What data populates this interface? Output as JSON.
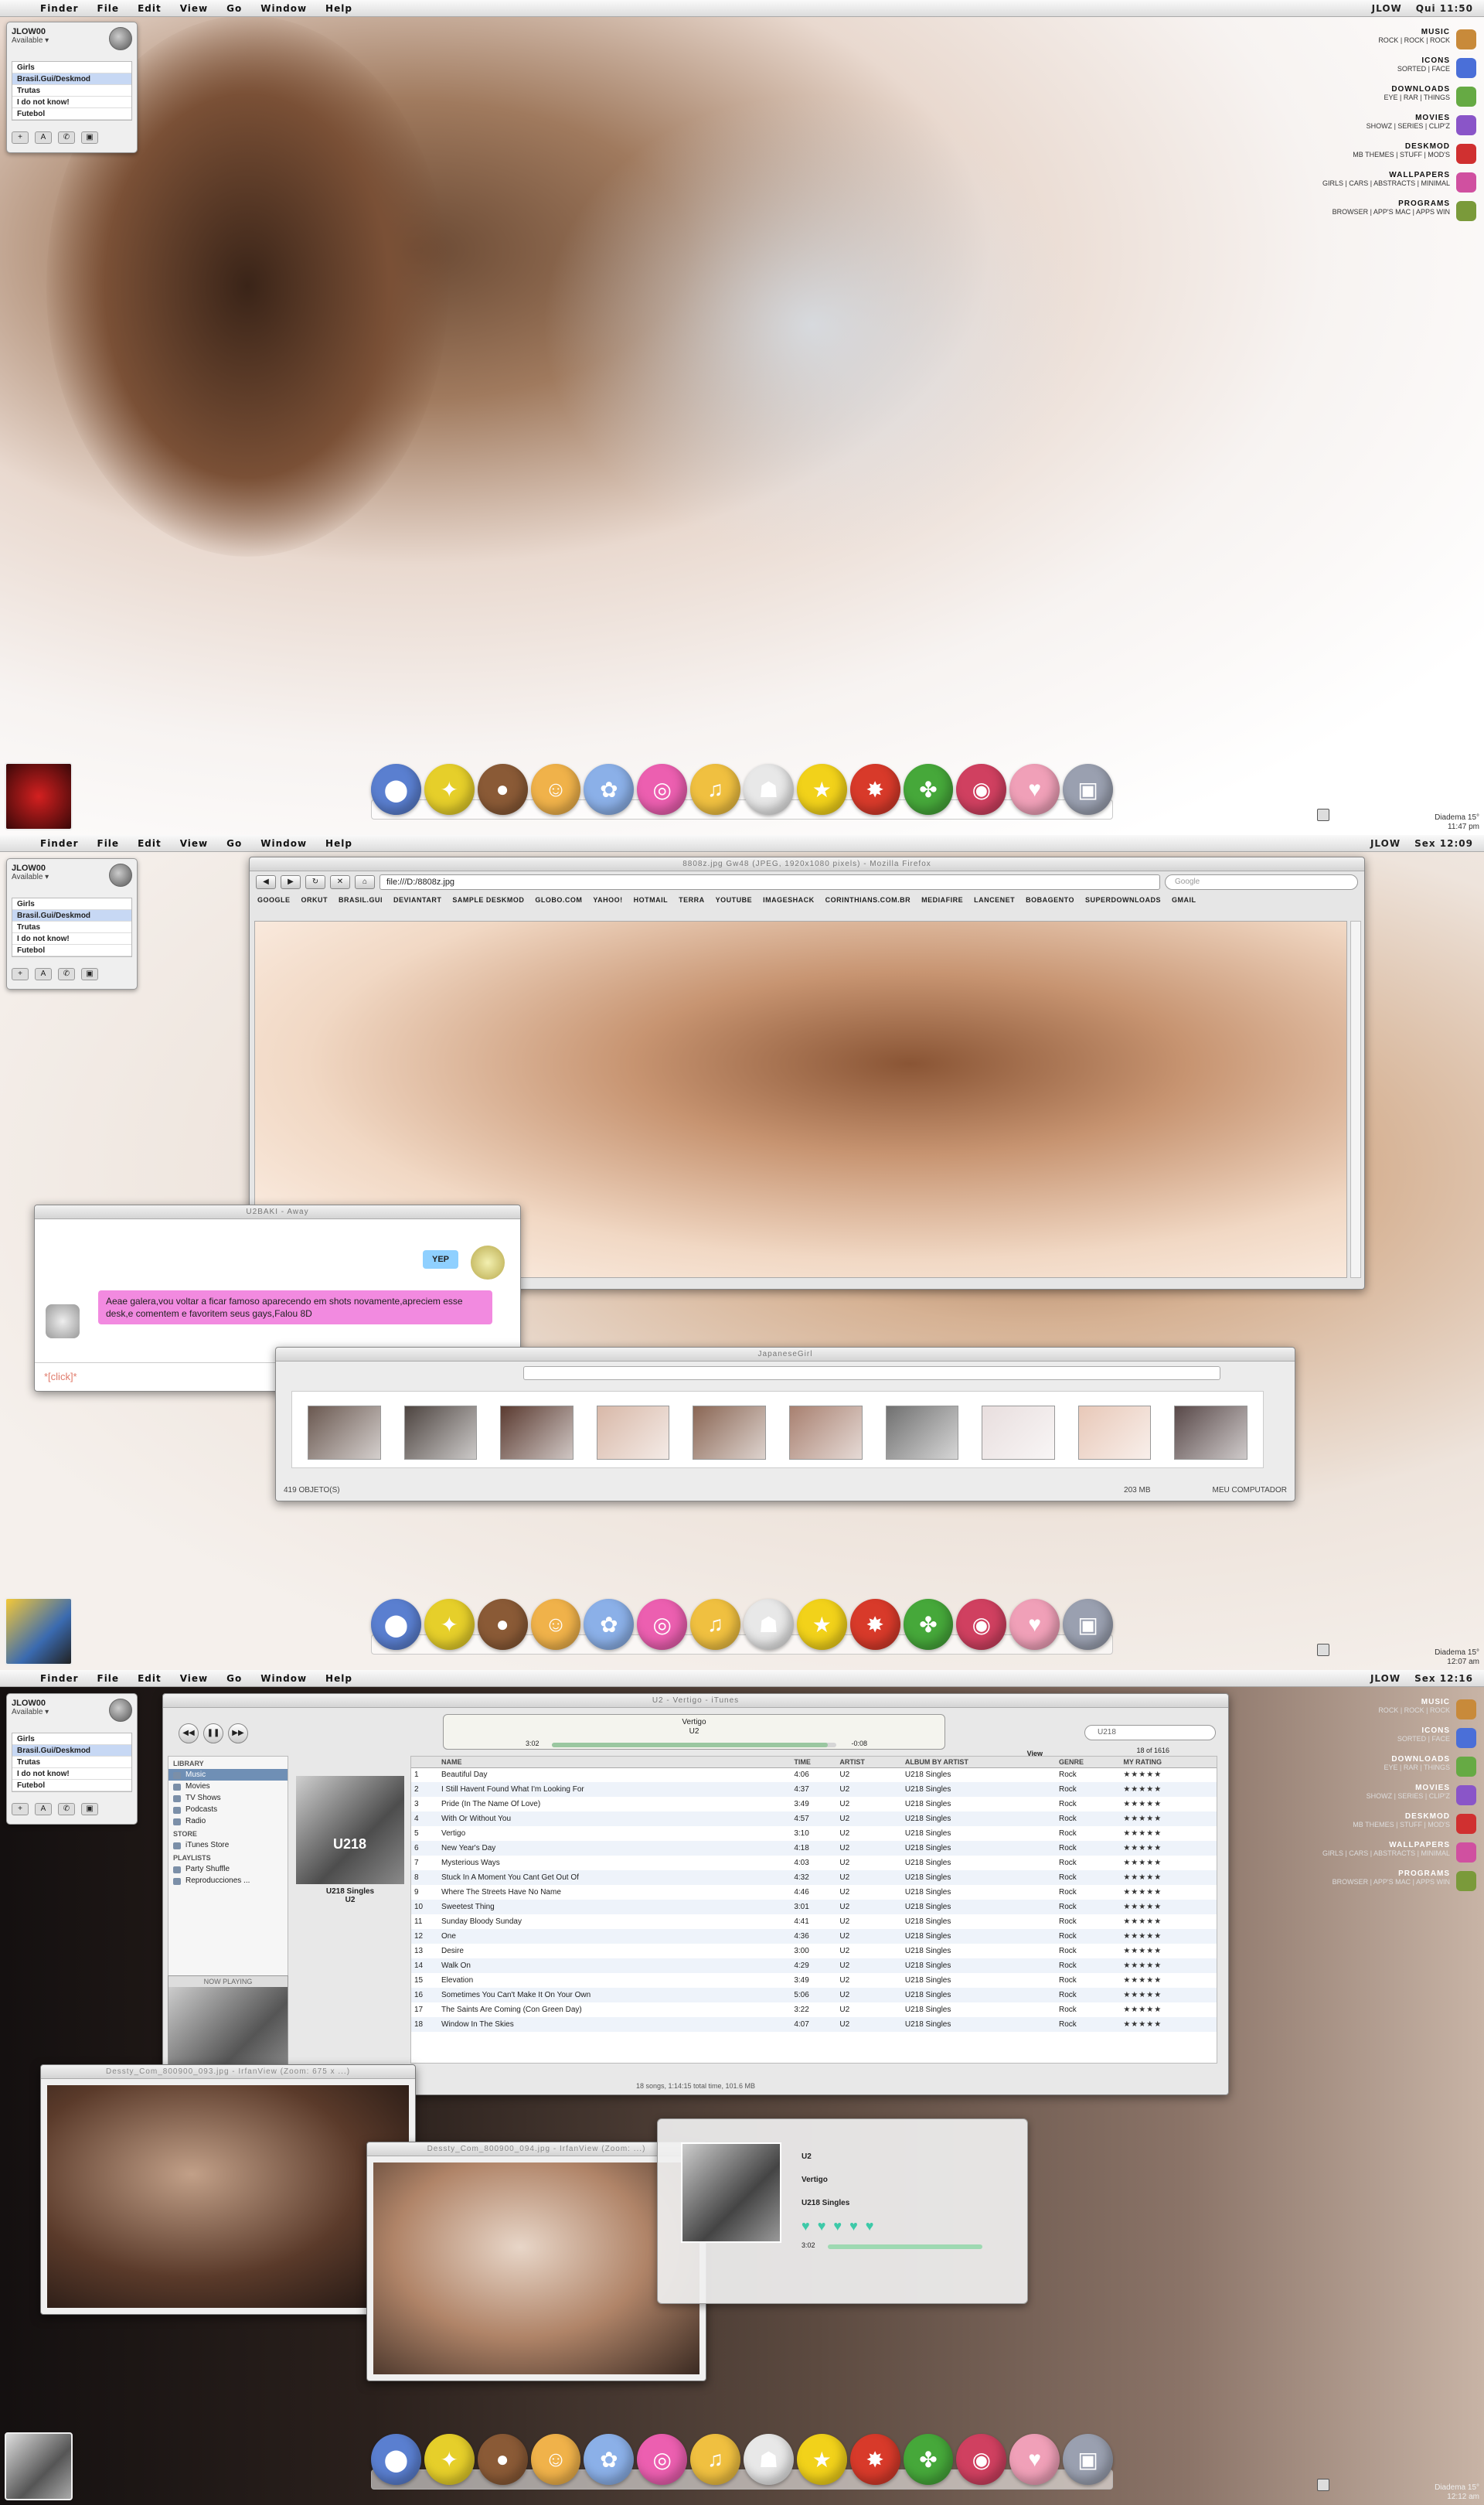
{
  "menu": [
    "Finder",
    "File",
    "Edit",
    "View",
    "Go",
    "Window",
    "Help"
  ],
  "screen1": {
    "user": "JLOW",
    "clock": "Qui 11:50",
    "corner_clock": [
      "Diadema  15°",
      "11:47 pm"
    ]
  },
  "screen2": {
    "user": "JLOW",
    "clock": "Sex 12:09",
    "corner_clock": [
      "Diadema  15°",
      "12:07 am"
    ]
  },
  "screen3": {
    "user": "JLOW",
    "clock": "Sex 12:16",
    "corner_clock": [
      "Diadema  15°",
      "12:12 am"
    ]
  },
  "buddy": {
    "name": "JLOW00",
    "status": "Available ▾",
    "groups": [
      "Girls",
      "Brasil.Gui/Deskmod",
      "Trutas",
      "I do not know!",
      "Futebol"
    ]
  },
  "sidelinks": [
    {
      "title": "Music",
      "sub": "rock | rock | rock",
      "color": "#c88a3a"
    },
    {
      "title": "Icons",
      "sub": "sorted | face",
      "color": "#4a6fd8"
    },
    {
      "title": "Downloads",
      "sub": "eye | rar | things",
      "color": "#66aa44"
    },
    {
      "title": "Movies",
      "sub": "showz | series | clip'z",
      "color": "#8a55c8"
    },
    {
      "title": "Deskmod",
      "sub": "mb themes | stuff | mod's",
      "color": "#d03030"
    },
    {
      "title": "Wallpapers",
      "sub": "girls | cars | abstracts | minimal",
      "color": "#d050a0"
    },
    {
      "title": "Programs",
      "sub": "browser | app's mac | apps win",
      "color": "#7a9a3a"
    }
  ],
  "dock_icons": [
    {
      "name": "bowtie-ball-icon",
      "color": "#5a7fd0",
      "glyph": "⬤"
    },
    {
      "name": "duck-icon",
      "color": "#e6cf2a",
      "glyph": "✦"
    },
    {
      "name": "bear-icon",
      "color": "#8a5a36",
      "glyph": "●"
    },
    {
      "name": "nerd-face-icon",
      "color": "#f0b24a",
      "glyph": "☺"
    },
    {
      "name": "bird-icon",
      "color": "#8bb0e8",
      "glyph": "✿"
    },
    {
      "name": "donut-icon",
      "color": "#ec5fb0",
      "glyph": "◎"
    },
    {
      "name": "music-note-icon",
      "color": "#f0c040",
      "glyph": "♫"
    },
    {
      "name": "stormtrooper-icon",
      "color": "#e8e8e8",
      "glyph": "☗"
    },
    {
      "name": "star-icon",
      "color": "#f2d21a",
      "glyph": "★"
    },
    {
      "name": "red-bird-icon",
      "color": "#d83a2a",
      "glyph": "✸"
    },
    {
      "name": "crocodile-icon",
      "color": "#46a83a",
      "glyph": "✤"
    },
    {
      "name": "red-ball-icon",
      "color": "#d04060",
      "glyph": "◉"
    },
    {
      "name": "pink-pig-icon",
      "color": "#f0a0b8",
      "glyph": "♥"
    },
    {
      "name": "trash-can-icon",
      "color": "#9aa0b0",
      "glyph": "▣"
    }
  ],
  "firefox": {
    "title": "8808z.jpg Gw48 (JPEG, 1920x1080 pixels) - Mozilla Firefox",
    "url": "file:///D:/8808z.jpg",
    "search_placeholder": "Google",
    "bookmarks": [
      "Google",
      "orkut",
      "Brasil.Gui",
      "deviantART",
      "Sample Deskmod",
      "Globo.com",
      "Yahoo!",
      "Hotmail",
      "Terra",
      "YouTube",
      "ImageShack",
      "Corinthians.com.br",
      "MediaFire",
      "Lancenet",
      "Bobagento",
      "Superdownloads",
      "Gmail"
    ]
  },
  "chat": {
    "title": "U2BAKI - Away",
    "reply": "YEP",
    "message": "Aeae galera,vou voltar a ficar famoso aparecendo em shots novamente,apreciem esse desk,e comentem e favoritem seus gays,Falou 8D",
    "input": "*[click]*"
  },
  "explorer": {
    "title": "JapaneseGirl",
    "status_left": "419 objeto(s)",
    "status_size": "203 MB",
    "status_right": "Meu computador",
    "thumb_colors": [
      "#6a5850",
      "#4d4440",
      "#5a3a30",
      "#d8b8a8",
      "#8a6654",
      "#a88070",
      "#707070",
      "#e8dede",
      "#e8c8b8",
      "#584848"
    ]
  },
  "itunes": {
    "title": "U2 - Vertigo - iTunes",
    "now_title": "Vertigo",
    "now_artist": "U2",
    "elapsed": "3:02",
    "remaining": "-0:08",
    "search_value": "U218",
    "count": "18 of 1616",
    "view_label": "View",
    "source": {
      "library_header": "Library",
      "library": [
        "Music",
        "Movies",
        "TV Shows",
        "Podcasts",
        "Radio"
      ],
      "store_header": "Store",
      "store": [
        "iTunes Store"
      ],
      "playlists_header": "Playlists",
      "playlists": [
        "Party Shuffle",
        "Reproducciones ..."
      ],
      "now_playing": "Now Playing"
    },
    "album_art_text": "U218",
    "album_title": "U218 Singles",
    "album_artist": "U2",
    "columns": [
      "",
      "Name",
      "Time",
      "Artist",
      "Album by Artist",
      "Genre",
      "My Rating"
    ],
    "tracks": [
      [
        "1",
        "Beautiful Day",
        "4:06",
        "U2",
        "U218 Singles",
        "Rock",
        "★★★★★"
      ],
      [
        "2",
        "I Still Havent Found What I'm Looking For",
        "4:37",
        "U2",
        "U218 Singles",
        "Rock",
        "★★★★★"
      ],
      [
        "3",
        "Pride (In The Name Of Love)",
        "3:49",
        "U2",
        "U218 Singles",
        "Rock",
        "★★★★★"
      ],
      [
        "4",
        "With Or Without You",
        "4:57",
        "U2",
        "U218 Singles",
        "Rock",
        "★★★★★"
      ],
      [
        "5",
        "Vertigo",
        "3:10",
        "U2",
        "U218 Singles",
        "Rock",
        "★★★★★"
      ],
      [
        "6",
        "New Year's Day",
        "4:18",
        "U2",
        "U218 Singles",
        "Rock",
        "★★★★★"
      ],
      [
        "7",
        "Mysterious Ways",
        "4:03",
        "U2",
        "U218 Singles",
        "Rock",
        "★★★★★"
      ],
      [
        "8",
        "Stuck In A Moment You Cant Get Out Of",
        "4:32",
        "U2",
        "U218 Singles",
        "Rock",
        "★★★★★"
      ],
      [
        "9",
        "Where The Streets Have No Name",
        "4:46",
        "U2",
        "U218 Singles",
        "Rock",
        "★★★★★"
      ],
      [
        "10",
        "Sweetest Thing",
        "3:01",
        "U2",
        "U218 Singles",
        "Rock",
        "★★★★★"
      ],
      [
        "11",
        "Sunday Bloody Sunday",
        "4:41",
        "U2",
        "U218 Singles",
        "Rock",
        "★★★★★"
      ],
      [
        "12",
        "One",
        "4:36",
        "U2",
        "U218 Singles",
        "Rock",
        "★★★★★"
      ],
      [
        "13",
        "Desire",
        "3:00",
        "U2",
        "U218 Singles",
        "Rock",
        "★★★★★"
      ],
      [
        "14",
        "Walk On",
        "4:29",
        "U2",
        "U218 Singles",
        "Rock",
        "★★★★★"
      ],
      [
        "15",
        "Elevation",
        "3:49",
        "U2",
        "U218 Singles",
        "Rock",
        "★★★★★"
      ],
      [
        "16",
        "Sometimes You Can't Make It On Your Own",
        "5:06",
        "U2",
        "U218 Singles",
        "Rock",
        "★★★★★"
      ],
      [
        "17",
        "The Saints Are Coming (Con Green Day)",
        "3:22",
        "U2",
        "U218 Singles",
        "Rock",
        "★★★★★"
      ],
      [
        "18",
        "Window In The Skies",
        "4:07",
        "U2",
        "U218 Singles",
        "Rock",
        "★★★★★"
      ]
    ],
    "status": "18 songs, 1:14:15 total time, 101.6 MB"
  },
  "irfan1": {
    "title": "Dessty_Com_800900_093.jpg - IrfanView (Zoom: 675 x ...)"
  },
  "irfan2": {
    "title": "Dessty_Com_800900_094.jpg - IrfanView (Zoom: ...)"
  },
  "miniplayer": {
    "artist": "U2",
    "track": "Vertigo",
    "album": "U218 Singles",
    "rating": "♥♥♥♥♥",
    "time": "3:02"
  },
  "accent": {
    "selection": "#c7d8f4",
    "itunes_progress": "#9ac7a0",
    "chat_bubble": "#f28ae0",
    "reply_bubble": "#8fd0ff"
  }
}
